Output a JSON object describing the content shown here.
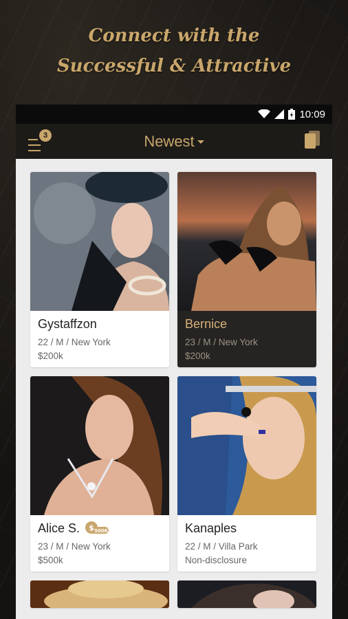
{
  "tagline": {
    "line1": "Connect with the",
    "line2": "Successful & Attractive"
  },
  "status_bar": {
    "time": "10:09"
  },
  "app_bar": {
    "badge_count": "3",
    "sort_title": "Newest"
  },
  "profiles": [
    {
      "name": "Gystaffzon",
      "meta": "22 / M / New York",
      "income": "$200k",
      "theme": "light"
    },
    {
      "name": "Bernice",
      "meta": "23 / M / New York",
      "income": "$200k",
      "theme": "dark"
    },
    {
      "name": "Alice S.",
      "meta": "23 / M / New York",
      "income": "$500k",
      "theme": "light",
      "verified_tag": "500K"
    },
    {
      "name": "Kanaples",
      "meta": "22 / M / Villa Park",
      "income": "Non-disclosure",
      "theme": "light"
    }
  ],
  "colors": {
    "gold": "#c9a66b",
    "appbar": "#1d1b18",
    "content_bg": "#ececec"
  }
}
